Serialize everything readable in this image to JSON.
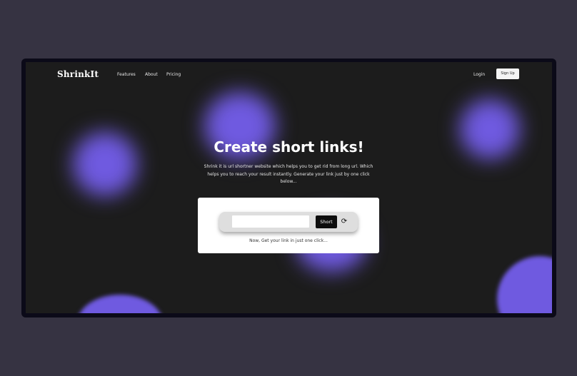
{
  "brand": {
    "name": "ShrinkIt",
    "accent": "#6f5ae0"
  },
  "nav": {
    "links": [
      "Features",
      "About",
      "Pricing"
    ],
    "login_label": "Login",
    "signup_label": "Sign Up"
  },
  "hero": {
    "title": "Create short links!",
    "description": "Shrink it is url shortner website which helps you to get rid from long url. Which helps you to reach your result instantly. Generate your link just by one click below..."
  },
  "shortener": {
    "input_value": "",
    "input_placeholder": "",
    "button_label": "Short",
    "refresh_icon": "refresh-icon",
    "note": "Now, Get your link in just one click..."
  }
}
